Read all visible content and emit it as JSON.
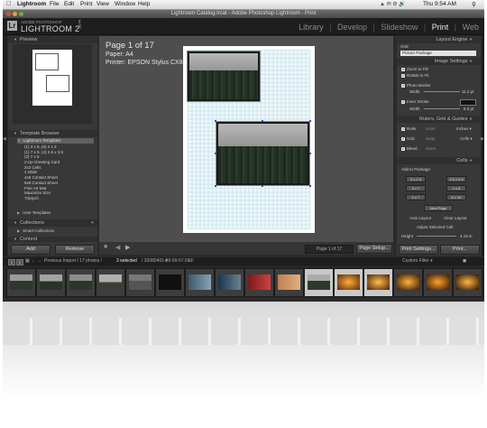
{
  "menubar": {
    "apple": "",
    "items": [
      "Lightroom",
      "File",
      "Edit",
      "Print",
      "View",
      "Window",
      "Help"
    ],
    "right": [
      "Thu 9:54 AM"
    ]
  },
  "window": {
    "title": "Lightroom Catalog.lrcat - Adobe Photoshop Lightroom - Print"
  },
  "identity": {
    "logo_small": "ADOBE PHOTOSHOP",
    "logo_big": "LIGHTROOM 2",
    "beta": "BETA",
    "modules": [
      "Library",
      "Develop",
      "Slideshow",
      "Print",
      "Web"
    ],
    "active_module": "Print"
  },
  "left_panel": {
    "preview_title": "Preview",
    "template_browser_title": "Template Browser",
    "templates_folder": "Lightroom Templates",
    "templates": [
      "(1) 4 x 6, (6) 2 x 3",
      "(1) 7 x 5, (4) 2.5 x 3.5",
      "(2) 7 x 5",
      "2-Up Greeting Card",
      "2x2 Cells",
      "4 Wide",
      "4x5 Contact Sheet",
      "5x8 Contact Sheet",
      "Fine Art Mat",
      "Maximize Size",
      "Triptych"
    ],
    "user_templates": "User Templates",
    "collections_title": "Collections",
    "smart_collections": "Smart Collections",
    "content_title": "Content",
    "add_button": "Add",
    "remove_button": "Remove"
  },
  "center": {
    "page_label": "Page 1 of 17",
    "paper_label": "Paper:  A4",
    "printer_label": "Printer:  EPSON Stylus CX8400",
    "page_counter": "Page 1 of 17",
    "page_setup_button": "Page Setup..."
  },
  "right_panel": {
    "layout_engine_title": "Layout Engine",
    "engine_options": [
      "Grid",
      "Picture Package"
    ],
    "image_settings_title": "Image Settings",
    "zoom_to_fill": "Zoom to Fill",
    "rotate_to_fit": "Rotate to Fit",
    "photo_border": "Photo Border",
    "width_label": "Width",
    "photo_border_value": "11.2 pt",
    "inner_stroke": "Inner Stroke",
    "inner_stroke_value": "6.0 pt",
    "rulers_title": "Rulers, Grid & Guides",
    "ruler_label": "Ruler",
    "units_label": "Units",
    "units_value": "Inches",
    "grid_label": "Grid",
    "snap_label": "Snap",
    "snap_value": "Cells",
    "bleed_label": "Bleed",
    "sizes_label": "Sizes",
    "cells_title": "Cells",
    "add_to_package": "Add to Package:",
    "cell_buttons": [
      "2 x 2.5",
      "2.5 x 3.5",
      "3 x 7",
      "4 x 6",
      "5 x 7",
      "8 x 10"
    ],
    "new_page_button": "New Page",
    "auto_layout_button": "Auto Layout",
    "clear_layout_button": "Clear Layout",
    "adjust_selected_cell": "Adjust Selected Cell:",
    "height_label": "Height",
    "height_value": "4.15 in",
    "print_settings_button": "Print Settings...",
    "print_button": "Print..."
  },
  "filmstrip": {
    "page_1": "1",
    "page_2": "2",
    "breadcrumb": "Previous Import / 17 photos /",
    "selected": "3 selected",
    "filename": "/ 20080401-20-59-57.NEF",
    "custom_filter": "Custom Filter"
  }
}
